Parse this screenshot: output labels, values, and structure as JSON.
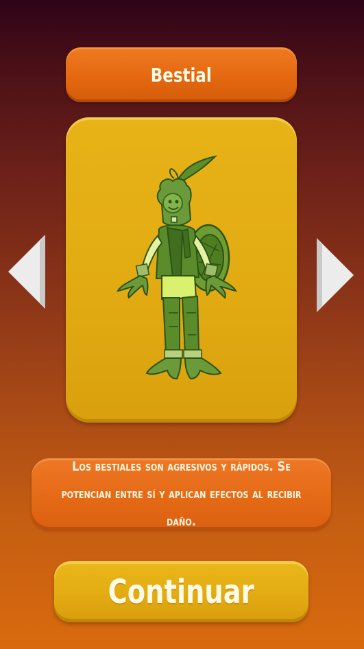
{
  "screen": {
    "title": "Bestial",
    "description": "Los bestiales son agresivos y rápidos. Se potencian entre sí y aplican efectos al recibir daño.",
    "continue_label": "Continuar"
  },
  "navigation": {
    "left_arrow_icon": "triangle-left-icon",
    "right_arrow_icon": "triangle-right-icon"
  },
  "character": {
    "icon": "beast-character-illustration"
  },
  "colors": {
    "background_top": "#2e0418",
    "background_bottom": "#d96a0e",
    "orange_panel": "#e4680f",
    "yellow_panel": "#e1aa12",
    "arrow_fill": "#ececec",
    "text": "#fffbe6"
  }
}
